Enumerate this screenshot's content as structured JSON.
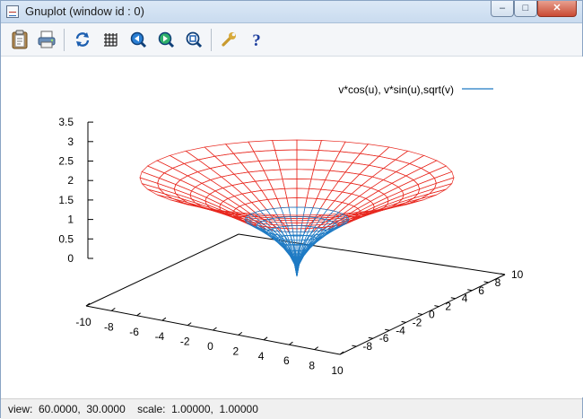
{
  "window": {
    "title": "Gnuplot (window id : 0)",
    "controls": {
      "minimize": "–",
      "maximize": "□",
      "close": "✕"
    }
  },
  "toolbar": {
    "items": [
      {
        "name": "copy-to-clipboard",
        "icon": "clipboard-icon"
      },
      {
        "name": "print",
        "icon": "printer-icon"
      },
      {
        "name": "replot",
        "icon": "refresh-icon"
      },
      {
        "name": "toggle-grid",
        "icon": "grid-icon"
      },
      {
        "name": "zoom-previous",
        "icon": "zoom-prev-icon"
      },
      {
        "name": "zoom-next",
        "icon": "zoom-next-icon"
      },
      {
        "name": "unzoom",
        "icon": "unzoom-icon"
      },
      {
        "name": "options",
        "icon": "wrench-icon"
      },
      {
        "name": "help",
        "icon": "help-icon"
      }
    ]
  },
  "plot": {
    "legend": "v*cos(u), v*sin(u),sqrt(v)",
    "colors": {
      "legend_line": "#1f7bc4",
      "upper_surface": "#e8281f",
      "lower_surface": "#1f7bc4"
    }
  },
  "chart_data": {
    "type": "surface3d",
    "function": "v*cos(u), v*sin(u),sqrt(v)",
    "series": [
      {
        "name": "v*cos(u), v*sin(u),sqrt(v)"
      }
    ],
    "view_rot_x": 60,
    "view_rot_z": 30,
    "zticks": [
      "0",
      "0.5",
      "1",
      "1.5",
      "2",
      "2.5",
      "3",
      "3.5"
    ],
    "xticks": [
      "-10",
      "-8",
      "-6",
      "-4",
      "-2",
      "0",
      "2",
      "4",
      "6",
      "8",
      "10"
    ],
    "yticks": [
      "-8",
      "-6",
      "-4",
      "-2",
      "0",
      "2",
      "4",
      "6",
      "8",
      "10"
    ],
    "zlim": [
      0,
      3.5
    ],
    "xlim": [
      -10,
      10
    ],
    "ylim": [
      -10,
      10
    ]
  },
  "status": {
    "text": "view:  60.0000,  30.0000    scale:  1.00000,  1.00000"
  }
}
